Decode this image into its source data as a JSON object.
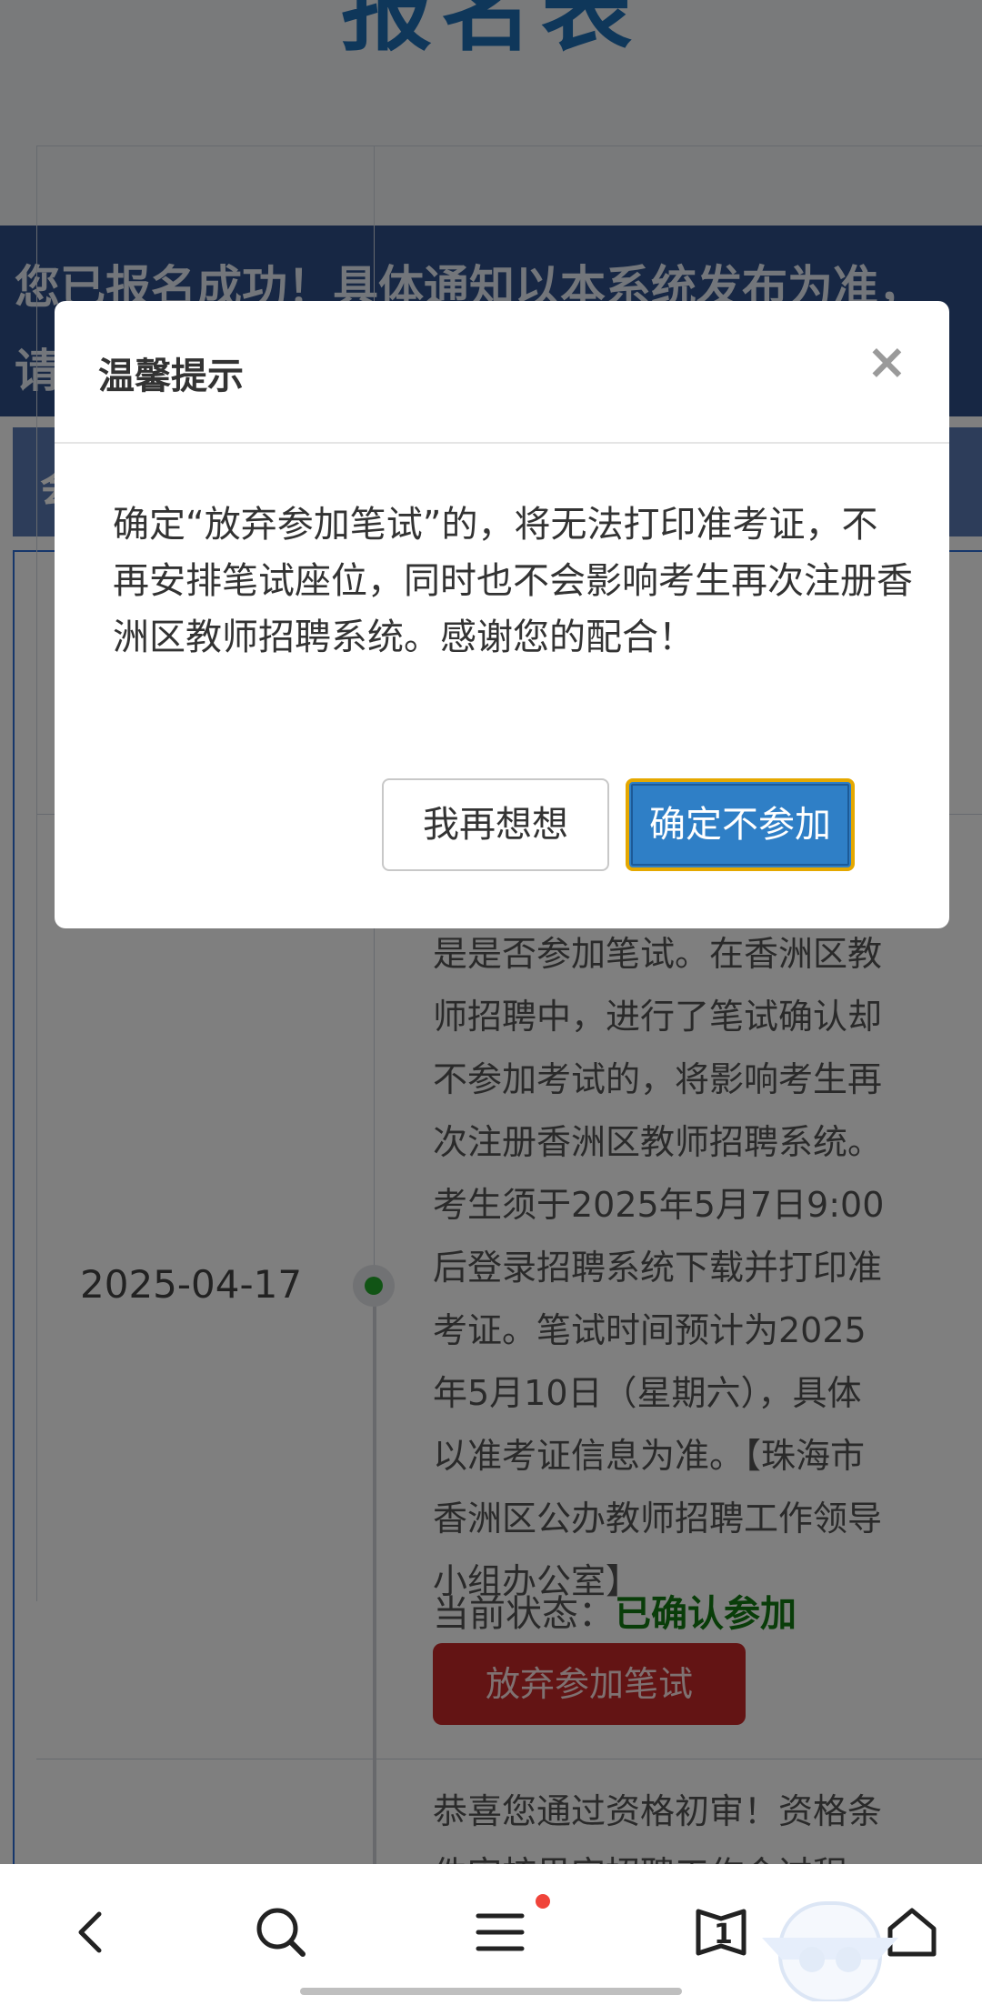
{
  "page": {
    "title": "报名表",
    "notice_lines": [
      "您已报名成功！具体通知以本系统发布为准，",
      "请"
    ],
    "section_title": "会",
    "timeline": {
      "date": "2025-04-17",
      "text_lines": [
        "是是否参加笔试。在香洲区教",
        "师招聘中，进行了笔试确认却",
        "不参加考试的，将影响考生再",
        "次注册香洲区教师招聘系统。",
        "考生须于2025年5月7日9:00",
        "后登录招聘系统下载并打印准",
        "考证。笔试时间预计为2025",
        "年5月10日（星期六），具体",
        "以准考证信息为准。【珠海市",
        "香洲区公办教师招聘工作领导",
        "小组办公室】"
      ],
      "status_label": "当前状态：",
      "status_value": "已确认参加",
      "give_up_button": "放弃参加笔试",
      "next_text_lines": [
        "恭喜您通过资格初审！资格条",
        "件审核果实招聘工作会过程"
      ]
    }
  },
  "modal": {
    "title": "温馨提示",
    "close_symbol": "×",
    "message": "确定“放弃参加笔试”的，将无法打印准考证，不再安排笔试座位，同时也不会影响考生再次注册香洲区教师招聘系统。感谢您的配合！",
    "cancel_label": "我再想想",
    "confirm_label": "确定不参加"
  },
  "bottom_nav": {
    "tabs_count": "1",
    "icons": [
      "back-icon",
      "search-icon",
      "menu-icon",
      "tabs-icon",
      "home-icon"
    ]
  },
  "colors": {
    "primary": "#2f7fc6",
    "danger": "#c62828",
    "success": "#127a12",
    "banner": "#2e4f88"
  }
}
